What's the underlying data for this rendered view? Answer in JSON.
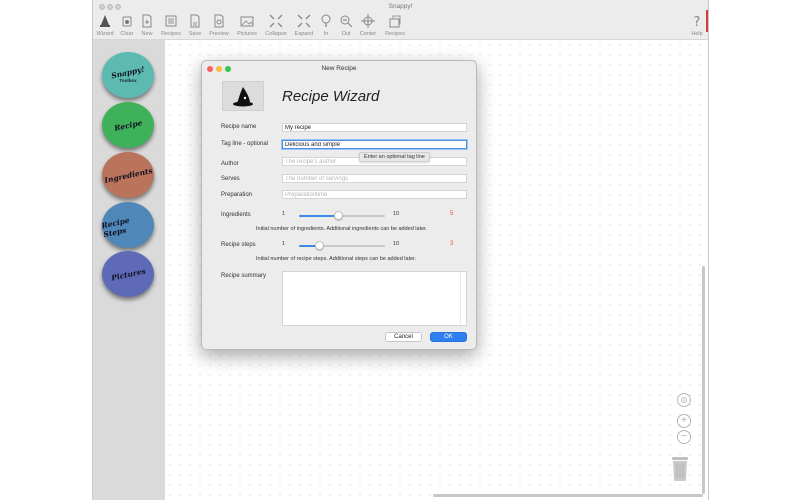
{
  "window": {
    "title": "Snappy!"
  },
  "toolbar": {
    "items": [
      {
        "label": "Wizard",
        "icon": "wizard-hat-icon"
      },
      {
        "label": "Clear",
        "icon": "clear-icon"
      },
      {
        "label": "New",
        "icon": "new-document-icon"
      },
      {
        "label": "Recipes",
        "icon": "recipes-icon"
      },
      {
        "label": "Save",
        "icon": "save-icon"
      },
      {
        "label": "Preview",
        "icon": "preview-icon"
      },
      {
        "label": "Pictures",
        "icon": "pictures-icon"
      },
      {
        "label": "Collapse",
        "icon": "collapse-icon"
      },
      {
        "label": "Expand",
        "icon": "expand-icon"
      },
      {
        "label": "In",
        "icon": "zoom-in-icon"
      },
      {
        "label": "Out",
        "icon": "zoom-out-icon"
      },
      {
        "label": "Center",
        "icon": "center-icon"
      },
      {
        "label": "Recipes",
        "icon": "share-recipes-icon"
      },
      {
        "label": "Help",
        "icon": "help-icon"
      }
    ]
  },
  "sidebar": {
    "orbs": [
      {
        "label": "Snappy!",
        "sub": "Toolbox",
        "color": "#5dbab0"
      },
      {
        "label": "Recipe",
        "sub": "",
        "color": "#3fb15a"
      },
      {
        "label": "Ingredients",
        "sub": "",
        "color": "#b9745b"
      },
      {
        "label": "Recipe Steps",
        "sub": "",
        "color": "#4f87b9"
      },
      {
        "label": "Pictures",
        "sub": "",
        "color": "#5e69b7"
      }
    ]
  },
  "dialog": {
    "title": "New Recipe",
    "heading": "Recipe Wizard",
    "fields": {
      "name": {
        "label": "Recipe name",
        "value": "My recipe",
        "placeholder": ""
      },
      "tagline": {
        "label": "Tag line - optional",
        "value": "Delicious and simple",
        "placeholder": ""
      },
      "author": {
        "label": "Author",
        "value": "",
        "placeholder": "The recipe's author"
      },
      "serves": {
        "label": "Serves",
        "value": "",
        "placeholder": "The number of servings"
      },
      "preparation": {
        "label": "Preparation",
        "value": "",
        "placeholder": "Preparationtime"
      }
    },
    "tooltip": "Enter an optional tag line",
    "ingredients": {
      "label": "Ingredients",
      "min": "1",
      "max": "10",
      "count": "5",
      "help": "Initial number of ingredients. Additional ingredients can be added later."
    },
    "steps": {
      "label": "Recipe steps",
      "min": "1",
      "max": "10",
      "count": "3",
      "help": "Initial number of recipe steps. Additional steps can be added later."
    },
    "summary": {
      "label": "Recipe summary"
    },
    "buttons": {
      "cancel": "Cancel",
      "ok": "OK"
    }
  },
  "colors": {
    "accent": "#2f7ff0",
    "count": "#e8542f"
  }
}
